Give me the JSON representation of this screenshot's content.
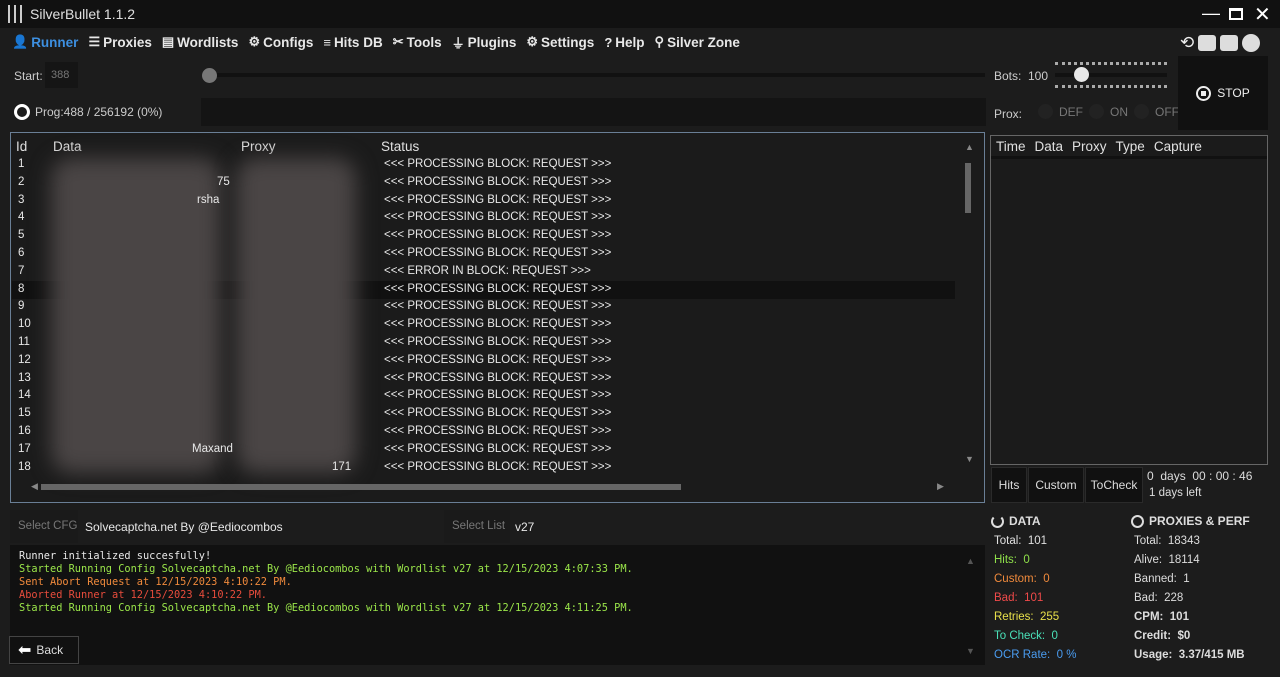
{
  "app": {
    "title": "SilverBullet 1.1.2"
  },
  "nav": [
    {
      "label": "Runner",
      "icon": "user-icon"
    },
    {
      "label": "Proxies",
      "icon": "server-icon"
    },
    {
      "label": "Wordlists",
      "icon": "files-icon"
    },
    {
      "label": "Configs",
      "icon": "gear-icon"
    },
    {
      "label": "Hits DB",
      "icon": "database-icon"
    },
    {
      "label": "Tools",
      "icon": "tools-icon"
    },
    {
      "label": "Plugins",
      "icon": "plug-icon"
    },
    {
      "label": "Settings",
      "icon": "cog-icon"
    },
    {
      "label": "Help",
      "icon": "help-icon"
    },
    {
      "label": "Silver Zone",
      "icon": "location-icon"
    }
  ],
  "controls": {
    "start_label": "Start:",
    "start_value": "388",
    "prog_text": "Prog:488 / 256192 (0%)",
    "bots_label": "Bots:",
    "bots_value": "100",
    "prox_label": "Prox:",
    "prox_options": [
      "DEF",
      "ON",
      "OFF"
    ],
    "stop_label": "STOP"
  },
  "table": {
    "headers": [
      "Id",
      "Data",
      "Proxy",
      "Status"
    ],
    "rows": [
      {
        "id": "1",
        "data": "",
        "proxy": "",
        "status": "<<< PROCESSING BLOCK: REQUEST >>>"
      },
      {
        "id": "2",
        "data": "75",
        "proxy": "",
        "status": "<<< PROCESSING BLOCK: REQUEST >>>"
      },
      {
        "id": "3",
        "data": "rsha",
        "proxy": "",
        "status": "<<< PROCESSING BLOCK: REQUEST >>>"
      },
      {
        "id": "4",
        "data": "",
        "proxy": "",
        "status": "<<< PROCESSING BLOCK: REQUEST >>>"
      },
      {
        "id": "5",
        "data": "",
        "proxy": "",
        "status": "<<< PROCESSING BLOCK: REQUEST >>>"
      },
      {
        "id": "6",
        "data": "",
        "proxy": "",
        "status": "<<< PROCESSING BLOCK: REQUEST >>>"
      },
      {
        "id": "7",
        "data": "",
        "proxy": "",
        "status": "<<< ERROR IN BLOCK: REQUEST >>>"
      },
      {
        "id": "8",
        "data": "",
        "proxy": "",
        "status": "<<< PROCESSING BLOCK: REQUEST >>>"
      },
      {
        "id": "9",
        "data": "",
        "proxy": "",
        "status": "<<< PROCESSING BLOCK: REQUEST >>>"
      },
      {
        "id": "10",
        "data": "",
        "proxy": "",
        "status": "<<< PROCESSING BLOCK: REQUEST >>>"
      },
      {
        "id": "11",
        "data": "",
        "proxy": "",
        "status": "<<< PROCESSING BLOCK: REQUEST >>>"
      },
      {
        "id": "12",
        "data": "",
        "proxy": "",
        "status": "<<< PROCESSING BLOCK: REQUEST >>>"
      },
      {
        "id": "13",
        "data": "",
        "proxy": "",
        "status": "<<< PROCESSING BLOCK: REQUEST >>>"
      },
      {
        "id": "14",
        "data": "",
        "proxy": "",
        "status": "<<< PROCESSING BLOCK: REQUEST >>>"
      },
      {
        "id": "15",
        "data": "",
        "proxy": "",
        "status": "<<< PROCESSING BLOCK: REQUEST >>>"
      },
      {
        "id": "16",
        "data": "",
        "proxy": "",
        "status": "<<< PROCESSING BLOCK: REQUEST >>>"
      },
      {
        "id": "17",
        "data": "Maxand",
        "proxy": "",
        "status": "<<< PROCESSING BLOCK: REQUEST >>>"
      },
      {
        "id": "18",
        "data": "",
        "proxy": "171",
        "status": "<<< PROCESSING BLOCK: REQUEST >>>"
      }
    ]
  },
  "hits_table": {
    "headers": [
      "Time",
      "Data",
      "Proxy",
      "Type",
      "Capture"
    ]
  },
  "tabs": [
    "Hits",
    "Custom",
    "ToCheck"
  ],
  "timer": {
    "elapsed": "0  days  00 : 00 : 46",
    "left": "1 days left"
  },
  "select": {
    "cfg_label": "Select CFG",
    "cfg_value": "Solvecaptcha.net By @Eediocombos",
    "list_label": "Select List",
    "list_value": "v27"
  },
  "log": [
    {
      "text": "Runner initialized succesfully!",
      "color": "#e8e8e8"
    },
    {
      "text": "Started Running Config Solvecaptcha.net By @Eediocombos with Wordlist v27 at 12/15/2023 4:07:33 PM.",
      "color": "#9be64a"
    },
    {
      "text": "Sent Abort Request at 12/15/2023 4:10:22 PM.",
      "color": "#f08a3c"
    },
    {
      "text": "Aborted Runner at 12/15/2023 4:10:22 PM.",
      "color": "#e84c3c"
    },
    {
      "text": "Started Running Config Solvecaptcha.net By @Eediocombos with Wordlist v27 at 12/15/2023 4:11:25 PM.",
      "color": "#9be64a"
    }
  ],
  "back_label": "Back",
  "data_stats": {
    "title": "DATA",
    "items": [
      {
        "label": "Total:",
        "value": "101",
        "color": "#e0e0e0"
      },
      {
        "label": "Hits:",
        "value": "0",
        "color": "#8fe04a"
      },
      {
        "label": "Custom:",
        "value": "0",
        "color": "#f08a3c"
      },
      {
        "label": "Bad:",
        "value": "101",
        "color": "#f04a4a"
      },
      {
        "label": "Retries:",
        "value": "255",
        "color": "#e8e04a"
      },
      {
        "label": "To Check:",
        "value": "0",
        "color": "#4ae0b8"
      },
      {
        "label": "OCR Rate:",
        "value": "0 %",
        "color": "#4a9cf0"
      }
    ]
  },
  "proxy_stats": {
    "title": "PROXIES & PERF",
    "items": [
      {
        "label": "Total:",
        "value": "18343",
        "bold": false
      },
      {
        "label": "Alive:",
        "value": "18114",
        "bold": false
      },
      {
        "label": "Banned:",
        "value": "1",
        "bold": false
      },
      {
        "label": "Bad:",
        "value": "228",
        "bold": false
      },
      {
        "label": "CPM:",
        "value": "101",
        "bold": true
      },
      {
        "label": "Credit:",
        "value": "$0",
        "bold": true
      },
      {
        "label": "Usage:",
        "value": "3.37/415 MB",
        "bold": true
      }
    ]
  }
}
